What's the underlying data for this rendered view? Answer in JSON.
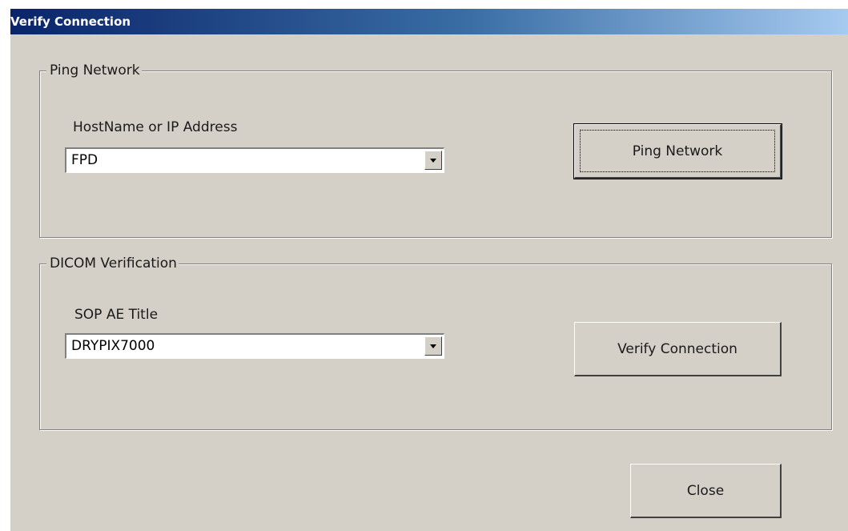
{
  "window": {
    "title": "Verify Connection"
  },
  "ping_group": {
    "legend": "Ping Network",
    "host_label": "HostName or IP Address",
    "host_value": "FPD",
    "ping_button": "Ping Network"
  },
  "dicom_group": {
    "legend": "DICOM Verification",
    "ae_label": "SOP AE Title",
    "ae_value": "DRYPIX7000",
    "verify_button": "Verify Connection"
  },
  "footer": {
    "close_button": "Close"
  },
  "colors": {
    "dialog_face": "#d4d0c8",
    "title_gradient_start": "#0a246a",
    "title_gradient_end": "#a6caf0",
    "title_text": "#ffffff"
  },
  "icons": [
    "chevron-down-icon"
  ]
}
